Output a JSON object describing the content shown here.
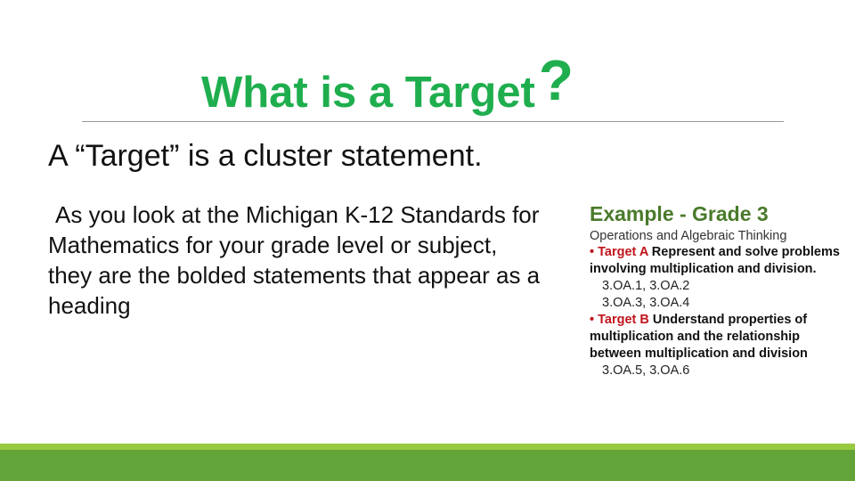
{
  "slide": {
    "title": "What is a Target",
    "title_mark": "?",
    "subtitle": "A “Target” is a cluster statement.",
    "body_lines": [
      "As you look at the Michigan K-12 Standards for",
      "Mathematics for your grade level or subject,",
      "they are the bolded statements that appear as a",
      "heading"
    ],
    "example": {
      "heading": "Example - Grade 3",
      "domain": "Operations and Algebraic Thinking",
      "targets": [
        {
          "bullet": "• ",
          "label": "Target A",
          "text": " Represent and solve problems involving multiplication and division.",
          "codes": [
            "3.OA.1, 3.OA.2",
            "3.OA.3, 3.OA.4"
          ]
        },
        {
          "bullet": "• ",
          "label": "Target B",
          "text": " Understand properties of multiplication and the relationship between multiplication and division",
          "codes": [
            "3.OA.5, 3.OA.6"
          ]
        }
      ]
    }
  },
  "colors": {
    "title": "#1fae4e",
    "example_heading": "#4a7a2b",
    "target_label": "#c0141c",
    "footer_light": "#99c940",
    "footer_dark": "#62a438"
  }
}
